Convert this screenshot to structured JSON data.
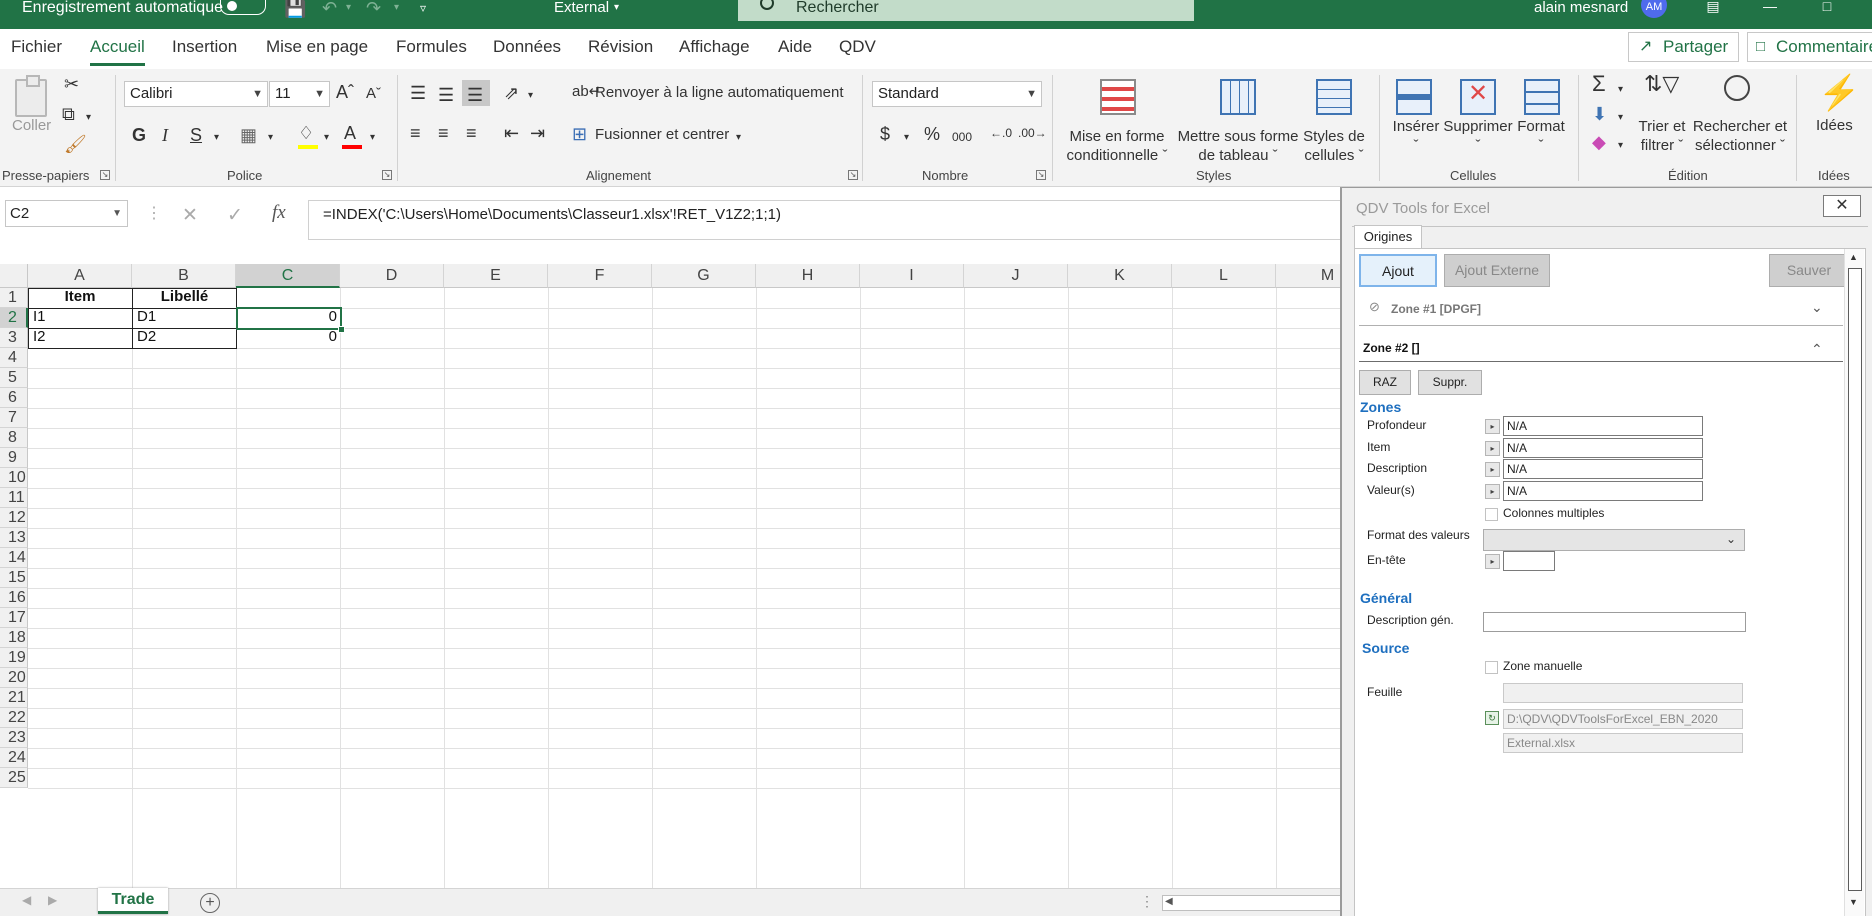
{
  "titlebar": {
    "autosave_label": "Enregistrement automatique",
    "document_name": "External",
    "search_placeholder": "Rechercher",
    "user_name": "alain mesnard",
    "avatar_initials": "AM"
  },
  "menu": {
    "tabs": [
      "Fichier",
      "Accueil",
      "Insertion",
      "Mise en page",
      "Formules",
      "Données",
      "Révision",
      "Affichage",
      "Aide",
      "QDV"
    ],
    "active_tab": "Accueil",
    "share_label": "Partager",
    "comments_label": "Commentaires"
  },
  "ribbon": {
    "clipboard": {
      "paste_label": "Coller",
      "group_label": "Presse-papiers"
    },
    "font": {
      "font_name": "Calibri",
      "font_size": "11",
      "group_label": "Police",
      "bold": "G",
      "italic": "I",
      "underline": "S"
    },
    "alignment": {
      "wrap_text": "Renvoyer à la ligne automatiquement",
      "merge_center": "Fusionner et centrer",
      "group_label": "Alignement"
    },
    "number": {
      "format": "Standard",
      "group_label": "Nombre"
    },
    "styles": {
      "conditional": [
        "Mise en forme",
        "conditionnelle"
      ],
      "format_table": [
        "Mettre sous forme",
        "de tableau"
      ],
      "cell_styles": [
        "Styles de",
        "cellules"
      ],
      "group_label": "Styles"
    },
    "cells": {
      "insert": "Insérer",
      "delete": "Supprimer",
      "format": "Format",
      "group_label": "Cellules"
    },
    "editing": {
      "sort_filter": [
        "Trier et",
        "filtrer"
      ],
      "find_select": [
        "Rechercher et",
        "sélectionner"
      ],
      "group_label": "Édition"
    },
    "ideas": {
      "label": "Idées",
      "group_label": "Idées"
    }
  },
  "formula_bar": {
    "name_box": "C2",
    "formula": "=INDEX('C:\\Users\\Home\\Documents\\Classeur1.xlsx'!RET_V1Z2;1;1)"
  },
  "sheet": {
    "columns": [
      "A",
      "B",
      "C",
      "D",
      "E",
      "F",
      "G",
      "H",
      "I",
      "J",
      "K",
      "L",
      "M"
    ],
    "rows": [
      "1",
      "2",
      "3",
      "4",
      "5",
      "6",
      "7",
      "8",
      "9",
      "10",
      "11",
      "12",
      "13",
      "14",
      "15",
      "16",
      "17",
      "18",
      "19",
      "20",
      "21",
      "22",
      "23",
      "24",
      "25"
    ],
    "header_row": [
      "Item",
      "Libellé"
    ],
    "data_rows": [
      [
        "I1",
        "D1",
        "0"
      ],
      [
        "I2",
        "D2",
        "0"
      ]
    ],
    "active_tab": "Trade"
  },
  "qdv_panel": {
    "title": "QDV Tools for Excel",
    "tab": "Origines",
    "buttons": {
      "add": "Ajout",
      "add_external": "Ajout Externe",
      "save": "Sauver"
    },
    "zone1": "Zone #1 [DPGF]",
    "zone2": "Zone #2 []",
    "raz": "RAZ",
    "delete": "Suppr.",
    "zones_section": "Zones",
    "fields": [
      {
        "label": "Profondeur",
        "value": "N/A"
      },
      {
        "label": "Item",
        "value": "N/A"
      },
      {
        "label": "Description",
        "value": "N/A"
      },
      {
        "label": "Valeur(s)",
        "value": "N/A"
      }
    ],
    "multi_columns": "Colonnes multiples",
    "value_format": "Format des valeurs",
    "header": "En-tête",
    "general_section": "Général",
    "general_description": "Description gén.",
    "source_section": "Source",
    "manual_zone": "Zone manuelle",
    "sheet_label": "Feuille",
    "path": "D:\\QDV\\QDVToolsForExcel_EBN_2020",
    "file": "External.xlsx"
  }
}
